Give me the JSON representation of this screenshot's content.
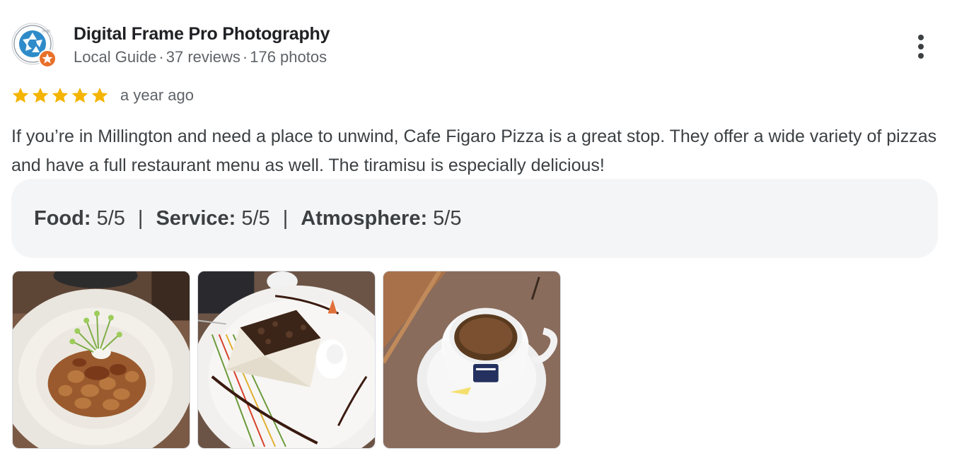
{
  "review": {
    "author": "Digital Frame Pro Photography",
    "meta": {
      "badge": "Local Guide",
      "reviews": "37 reviews",
      "photos": "176 photos",
      "separator": "·"
    },
    "rating": 5,
    "rating_max": 5,
    "time": "a year ago",
    "text": "If you’re in Millington and need a place to unwind, Cafe Figaro Pizza is a great stop. They offer a wide variety of pizzas and have a full restaurant menu as well. The tiramisu is especially delicious!",
    "attributes": [
      {
        "name": "Food:",
        "value": "5/5"
      },
      {
        "name": "Service:",
        "value": "5/5"
      },
      {
        "name": "Atmosphere:",
        "value": "5/5"
      }
    ],
    "attribute_separator": "|",
    "photos": [
      {
        "icon": "pasta-dish-photo"
      },
      {
        "icon": "tiramisu-photo"
      },
      {
        "icon": "espresso-cup-photo"
      }
    ]
  },
  "colors": {
    "star": "#f4b400",
    "meta_text": "#5f6368",
    "attribute_bg": "#f4f5f7",
    "avatar_ring": "#2e8bc9",
    "badge": "#e8702a"
  }
}
